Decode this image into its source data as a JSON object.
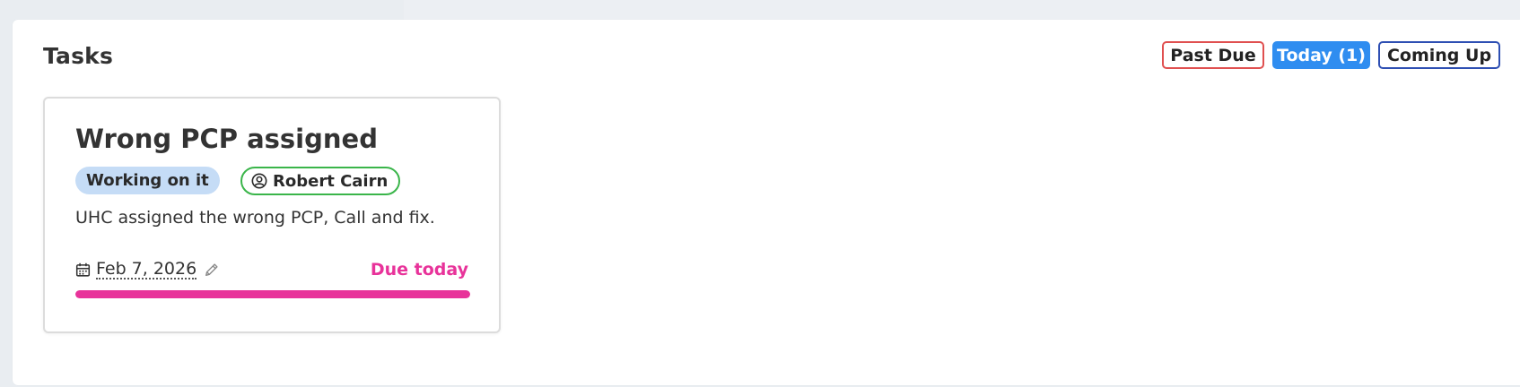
{
  "panel": {
    "title": "Tasks"
  },
  "filters": [
    {
      "label": "Past Due",
      "color": "#e05050",
      "active": false
    },
    {
      "label": "Today (1)",
      "color": "#2f8df0",
      "active": true
    },
    {
      "label": "Coming Up",
      "color": "#2e4fb3",
      "active": false
    }
  ],
  "task": {
    "title": "Wrong PCP assigned",
    "status": "Working on it",
    "assignee": "Robert Cairn",
    "description": "UHC assigned the wrong PCP, Call and fix.",
    "due_date": "Feb 7, 2026",
    "due_label": "Due today",
    "progress": 1.0,
    "accent_color": "#e8339a",
    "status_color": "#c5dcf6",
    "assignee_border_color": "#3ab54a",
    "icons": {
      "assignee": "user-circle-icon",
      "date": "calendar-icon",
      "edit": "pencil-icon"
    }
  }
}
